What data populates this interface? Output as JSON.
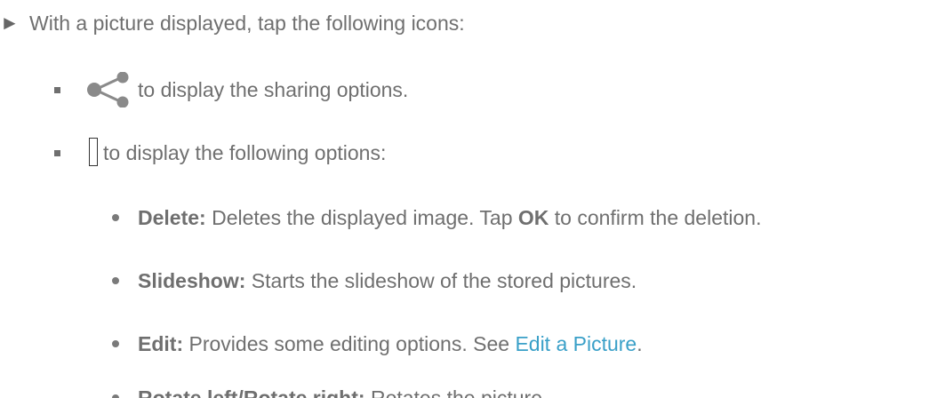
{
  "intro": {
    "arrow": "►",
    "text": "With a picture displayed, tap the following icons:"
  },
  "items": [
    {
      "icon": "share-icon",
      "text": "to display the sharing options."
    },
    {
      "icon": "more-options-icon",
      "text": "to display the following options:"
    }
  ],
  "options": [
    {
      "term": "Delete:",
      "text_before": " Deletes the displayed image. Tap ",
      "emphasis": "OK",
      "text_after": " to confirm the deletion."
    },
    {
      "term": "Slideshow:",
      "text": " Starts the slideshow of the stored pictures."
    },
    {
      "term": "Edit:",
      "text": " Provides some editing options. See ",
      "link": "Edit a Picture",
      "text_after": "."
    },
    {
      "term": "Rotate left/Rotate right:",
      "text": " Rotates the picture."
    }
  ],
  "colors": {
    "text": "#6f6f6f",
    "link": "#3aa0c8",
    "icon": "#8a8a8a"
  }
}
